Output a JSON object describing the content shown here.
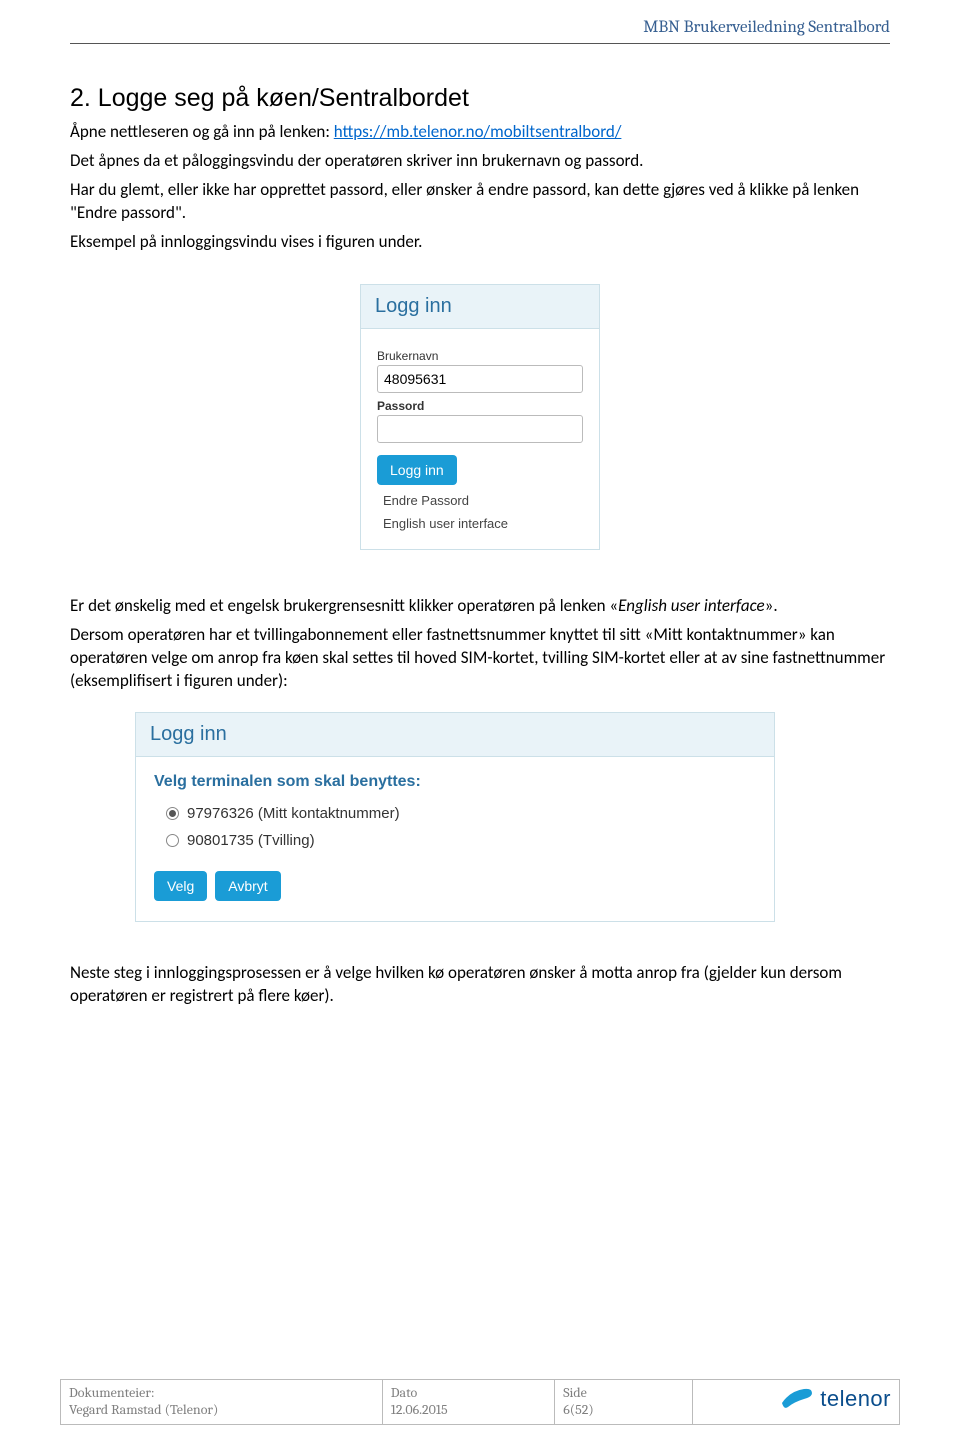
{
  "header": {
    "title": "MBN Brukerveiledning Sentralbord"
  },
  "section": {
    "heading": "2. Logge seg på køen/Sentralbordet",
    "p1a": "Åpne nettleseren og gå inn på lenken: ",
    "p1_link": "https://mb.telenor.no/mobiltsentralbord/",
    "p2": "Det åpnes da et påloggingsvindu der operatøren skriver inn brukernavn og passord.",
    "p3": "Har du glemt, eller ikke har opprettet passord, eller ønsker å endre passord, kan dette gjøres ved å klikke på lenken \"Endre passord\".",
    "p4": "Eksempel på innloggingsvindu vises i figuren under.",
    "p5a": "Er det ønskelig med et engelsk brukergrensesnitt klikker operatøren på lenken «",
    "p5_em": "English user interface",
    "p5b": "».",
    "p6": "Dersom operatøren har et tvillingabonnement eller fastnettsnummer knyttet til sitt «Mitt kontaktnummer» kan operatøren velge om anrop fra køen skal settes til hoved SIM-kortet, tvilling SIM-kortet eller at av sine fastnettnummer (eksemplifisert i figuren under):",
    "p7": "Neste steg i innloggingsprosessen er å velge hvilken kø operatøren ønsker å motta anrop fra (gjelder kun dersom operatøren er registrert på flere køer)."
  },
  "login1": {
    "title": "Logg inn",
    "user_label": "Brukernavn",
    "user_value": "48095631",
    "pass_label": "Passord",
    "submit": "Logg inn",
    "change_pw": "Endre Passord",
    "english": "English user interface"
  },
  "login2": {
    "title": "Logg inn",
    "prompt": "Velg terminalen som skal benyttes:",
    "opt1": "97976326 (Mitt kontaktnummer)",
    "opt2": "90801735 (Tvilling)",
    "select": "Velg",
    "cancel": "Avbryt"
  },
  "footer": {
    "owner_label": "Dokumenteier:",
    "owner_value": "Vegard Ramstad (Telenor)",
    "date_label": "Dato",
    "date_value": "12.06.2015",
    "page_label": "Side",
    "page_value": "6(52)",
    "logo_text": "telenor"
  }
}
